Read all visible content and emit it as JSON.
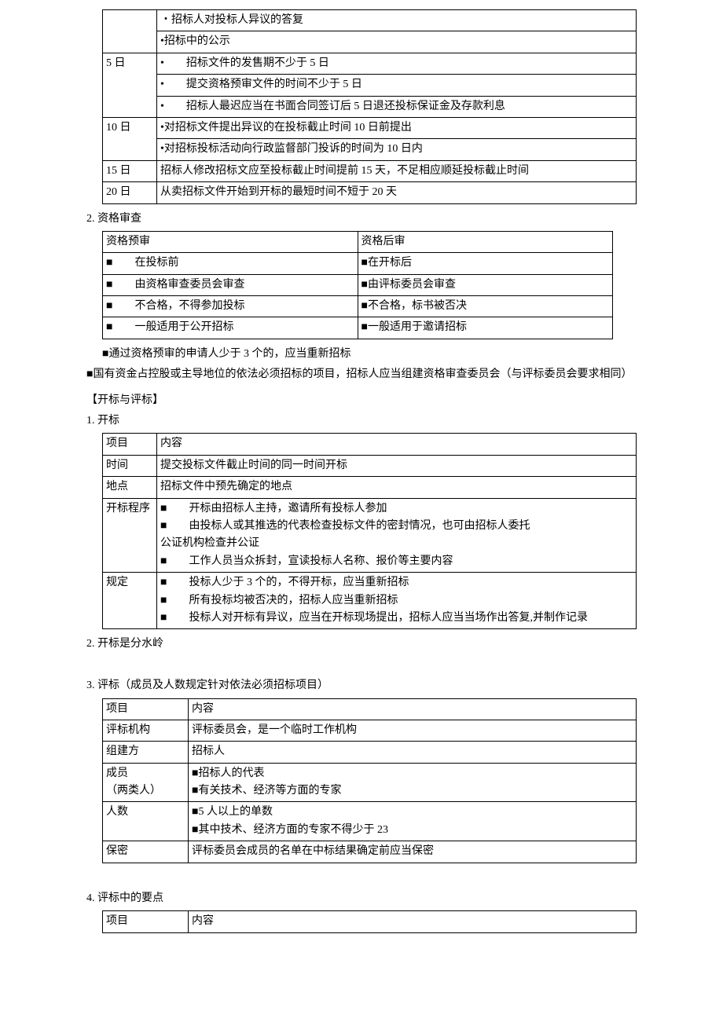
{
  "table1": {
    "r0": "・招标人对投标人异议的答复",
    "r1": "•招标中的公示",
    "r2_label": "5 日",
    "r2_a": "•　　招标文件的发售期不少于 5 日",
    "r2_b": "•　　提交资格预审文件的时间不少于 5 日",
    "r2_c": "•　　招标人最迟应当在书面合同签订后 5 日退还投标保证金及存款利息",
    "r3_label": "10 日",
    "r3_a": "•对招标文件提出异议的在投标截止时间 10 日前提出",
    "r3_b": "•对招标投标活动向行政监督部门投诉的时间为 10 日内",
    "r4_label": "15 日",
    "r4_a": "招标人修改招标文应至投标截止时间提前 15 天，不足相应顺延投标截止时间",
    "r5_label": "20 日",
    "r5_a": "从卖招标文件开始到开标的最短时间不短于 20 天"
  },
  "heading2": "2. 资格审查",
  "table2": {
    "h1": "资格预审",
    "h2": "资格后审",
    "r1_a": "■　　在投标前",
    "r1_b": "■在开标后",
    "r2_a": "■　　由资格审查委员会审查",
    "r2_b": "■由评标委员会审查",
    "r3_a": "■　　不合格，不得参加投标",
    "r3_b": "■不合格，标书被否决",
    "r4_a": "■　　一般适用于公开招标",
    "r4_b": "■一般适用于邀请招标"
  },
  "note1": "■通过资格预审的申请人少于 3 个的，应当重新招标",
  "note2": "■国有资金占控股或主导地位的依法必须招标的项目，招标人应当组建资格审查委员会（与评标委员会要求相同）",
  "section1": "【开标与评标】",
  "heading3": "1. 开标",
  "table3": {
    "h1": "项目",
    "h2": "内容",
    "r1_a": "时间",
    "r1_b": "提交投标文件截止时间的同一时间开标",
    "r2_a": "地点",
    "r2_b": "招标文件中预先确定的地点",
    "r3_a": "开标程序",
    "r3_b1": "■　　开标由招标人主持，邀请所有投标人参加",
    "r3_b2": "■　　由投标人或其推选的代表检查投标文件的密封情况，也可由招标人委托",
    "r3_b3": "公证机构检查并公证",
    "r3_b4": "■　　工作人员当众拆封，宣读投标人名称、报价等主要内容",
    "r4_a": "规定",
    "r4_b1": "■　　投标人少于 3 个的，不得开标，应当重新招标",
    "r4_b2": "■　　所有投标均被否决的，招标人应当重新招标",
    "r4_b3": "■　　投标人对开标有异议，应当在开标现场提出，招标人应当当场作出答复,并制作记录"
  },
  "heading4": "2. 开标是分水岭",
  "heading5": "3. 评标（成员及人数规定针对依法必须招标项目）",
  "table4": {
    "h1": "项目",
    "h2": "内容",
    "r1_a": "评标机构",
    "r1_b": "评标委员会，是一个临时工作机构",
    "r2_a": "组建方",
    "r2_b": "招标人",
    "r3_a": "成员",
    "r3_a2": "（两类人）",
    "r3_b1": "■招标人的代表",
    "r3_b2": "■有关技术、经济等方面的专家",
    "r4_a": "人数",
    "r4_b1": "■5 人以上的单数",
    "r4_b2": "■其中技术、经济方面的专家不得少于 23",
    "r5_a": "保密",
    "r5_b": "评标委员会成员的名单在中标结果确定前应当保密"
  },
  "heading6": "4. 评标中的要点",
  "table5": {
    "h1": "项目",
    "h2": "内容"
  }
}
